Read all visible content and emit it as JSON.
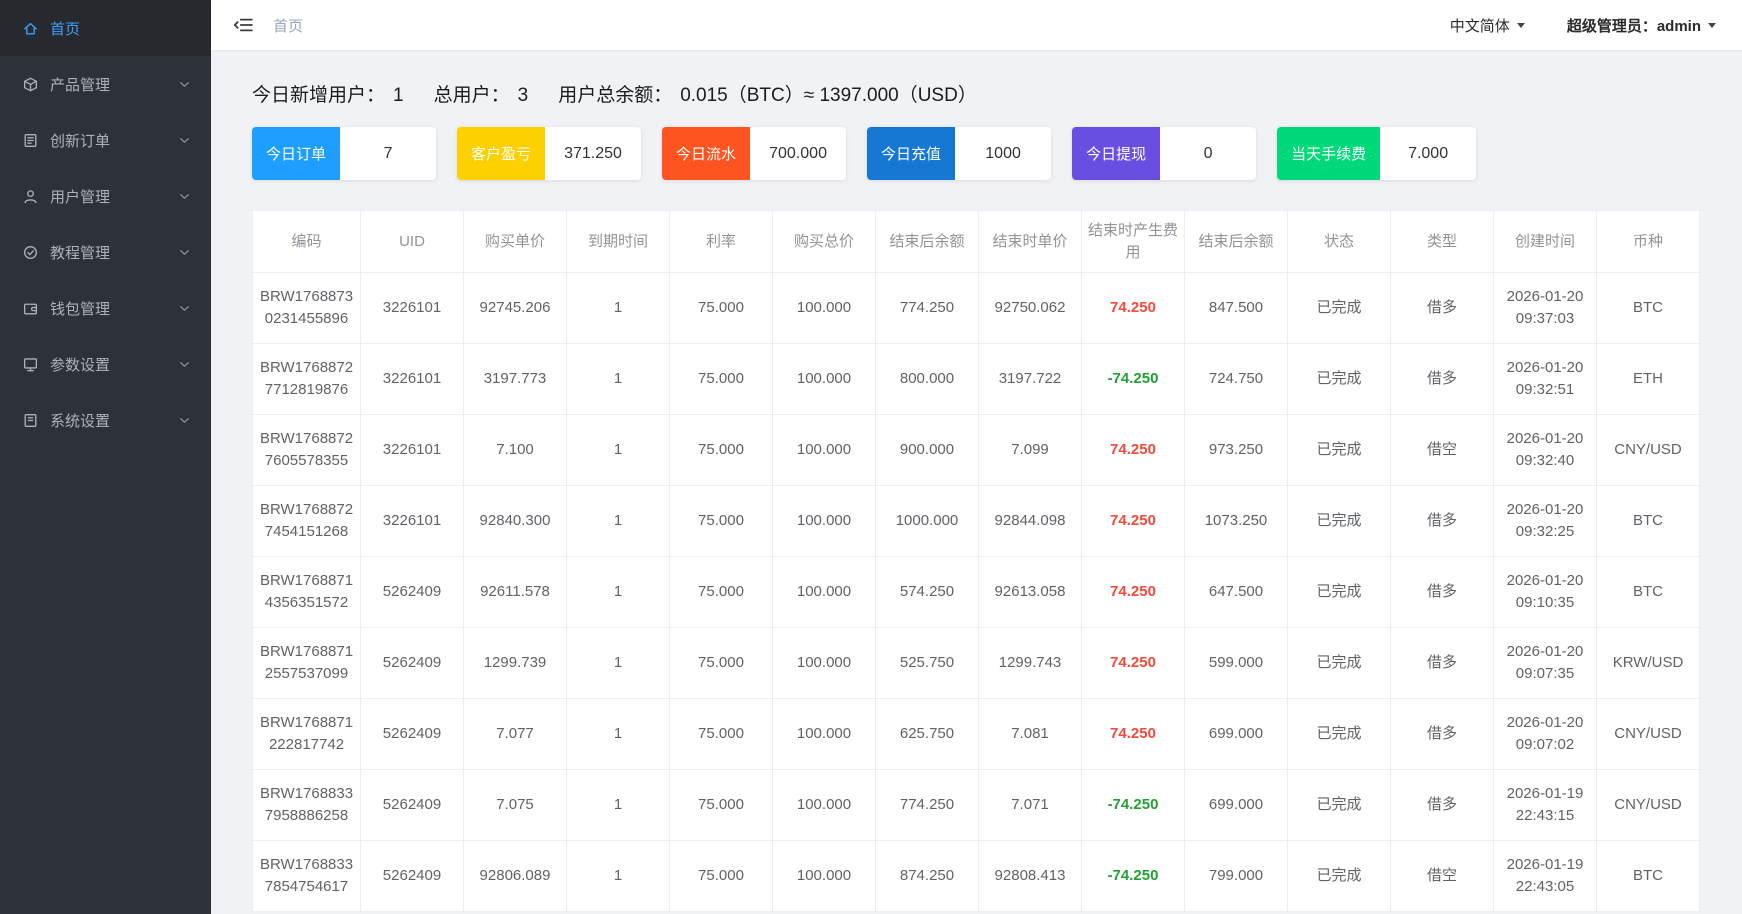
{
  "colors": {
    "fee_positive": "#f24a3b",
    "fee_negative": "#23a035",
    "sidebar_active": "#409eff"
  },
  "topbar": {
    "breadcrumb": "首页",
    "language": "中文简体",
    "user": "超级管理员：admin"
  },
  "sidebar": {
    "items": [
      {
        "key": "home",
        "label": "首页",
        "active": true,
        "expandable": false
      },
      {
        "key": "product",
        "label": "产品管理",
        "active": false,
        "expandable": true
      },
      {
        "key": "order",
        "label": "创新订单",
        "active": false,
        "expandable": true
      },
      {
        "key": "user",
        "label": "用户管理",
        "active": false,
        "expandable": true
      },
      {
        "key": "tutorial",
        "label": "教程管理",
        "active": false,
        "expandable": true
      },
      {
        "key": "wallet",
        "label": "钱包管理",
        "active": false,
        "expandable": true
      },
      {
        "key": "params",
        "label": "参数设置",
        "active": false,
        "expandable": true
      },
      {
        "key": "system",
        "label": "系统设置",
        "active": false,
        "expandable": true
      }
    ]
  },
  "summary": {
    "items": [
      {
        "label": "今日新增用户：",
        "value": "1"
      },
      {
        "label": "总用户：",
        "value": "3"
      },
      {
        "label": "用户总余额：",
        "value": "0.015（BTC）≈ 1397.000（USD）"
      }
    ]
  },
  "stat_cards": [
    {
      "label": "今日订单",
      "value": "7",
      "color": "#1e9fff"
    },
    {
      "label": "客户盈亏",
      "value": "371.250",
      "color": "#fdd000"
    },
    {
      "label": "今日流水",
      "value": "700.000",
      "color": "#ff5420"
    },
    {
      "label": "今日充值",
      "value": "1000",
      "color": "#1678d3"
    },
    {
      "label": "今日提现",
      "value": "0",
      "color": "#6a4ee1"
    },
    {
      "label": "当天手续费",
      "value": "7.000",
      "color": "#00d97a"
    }
  ],
  "table": {
    "headers": [
      "编码",
      "UID",
      "购买单价",
      "到期时间",
      "利率",
      "购买总价",
      "结束后余额",
      "结束时单价",
      "结束时产生费用",
      "结束后余额",
      "状态",
      "类型",
      "创建时间",
      "币种"
    ],
    "rows": [
      {
        "code": "BRW17688730231455896",
        "uid": "3226101",
        "buy_price": "92745.206",
        "expire": "1",
        "rate": "75.000",
        "total": "100.000",
        "balance_after": "774.250",
        "end_price": "92750.062",
        "fee": "74.250",
        "end_balance": "847.500",
        "status": "已完成",
        "type": "借多",
        "created": "2026-01-20 09:37:03",
        "currency": "BTC"
      },
      {
        "code": "BRW17688727712819876",
        "uid": "3226101",
        "buy_price": "3197.773",
        "expire": "1",
        "rate": "75.000",
        "total": "100.000",
        "balance_after": "800.000",
        "end_price": "3197.722",
        "fee": "-74.250",
        "end_balance": "724.750",
        "status": "已完成",
        "type": "借多",
        "created": "2026-01-20 09:32:51",
        "currency": "ETH"
      },
      {
        "code": "BRW17688727605578355",
        "uid": "3226101",
        "buy_price": "7.100",
        "expire": "1",
        "rate": "75.000",
        "total": "100.000",
        "balance_after": "900.000",
        "end_price": "7.099",
        "fee": "74.250",
        "end_balance": "973.250",
        "status": "已完成",
        "type": "借空",
        "created": "2026-01-20 09:32:40",
        "currency": "CNY/USD"
      },
      {
        "code": "BRW17688727454151268",
        "uid": "3226101",
        "buy_price": "92840.300",
        "expire": "1",
        "rate": "75.000",
        "total": "100.000",
        "balance_after": "1000.000",
        "end_price": "92844.098",
        "fee": "74.250",
        "end_balance": "1073.250",
        "status": "已完成",
        "type": "借多",
        "created": "2026-01-20 09:32:25",
        "currency": "BTC"
      },
      {
        "code": "BRW17688714356351572",
        "uid": "5262409",
        "buy_price": "92611.578",
        "expire": "1",
        "rate": "75.000",
        "total": "100.000",
        "balance_after": "574.250",
        "end_price": "92613.058",
        "fee": "74.250",
        "end_balance": "647.500",
        "status": "已完成",
        "type": "借多",
        "created": "2026-01-20 09:10:35",
        "currency": "BTC"
      },
      {
        "code": "BRW17688712557537099",
        "uid": "5262409",
        "buy_price": "1299.739",
        "expire": "1",
        "rate": "75.000",
        "total": "100.000",
        "balance_after": "525.750",
        "end_price": "1299.743",
        "fee": "74.250",
        "end_balance": "599.000",
        "status": "已完成",
        "type": "借多",
        "created": "2026-01-20 09:07:35",
        "currency": "KRW/USD"
      },
      {
        "code": "BRW1768871222817742",
        "uid": "5262409",
        "buy_price": "7.077",
        "expire": "1",
        "rate": "75.000",
        "total": "100.000",
        "balance_after": "625.750",
        "end_price": "7.081",
        "fee": "74.250",
        "end_balance": "699.000",
        "status": "已完成",
        "type": "借多",
        "created": "2026-01-20 09:07:02",
        "currency": "CNY/USD"
      },
      {
        "code": "BRW17688337958886258",
        "uid": "5262409",
        "buy_price": "7.075",
        "expire": "1",
        "rate": "75.000",
        "total": "100.000",
        "balance_after": "774.250",
        "end_price": "7.071",
        "fee": "-74.250",
        "end_balance": "699.000",
        "status": "已完成",
        "type": "借多",
        "created": "2026-01-19 22:43:15",
        "currency": "CNY/USD"
      },
      {
        "code": "BRW17688337854754617",
        "uid": "5262409",
        "buy_price": "92806.089",
        "expire": "1",
        "rate": "75.000",
        "total": "100.000",
        "balance_after": "874.250",
        "end_price": "92808.413",
        "fee": "-74.250",
        "end_balance": "799.000",
        "status": "已完成",
        "type": "借空",
        "created": "2026-01-19 22:43:05",
        "currency": "BTC"
      }
    ]
  }
}
